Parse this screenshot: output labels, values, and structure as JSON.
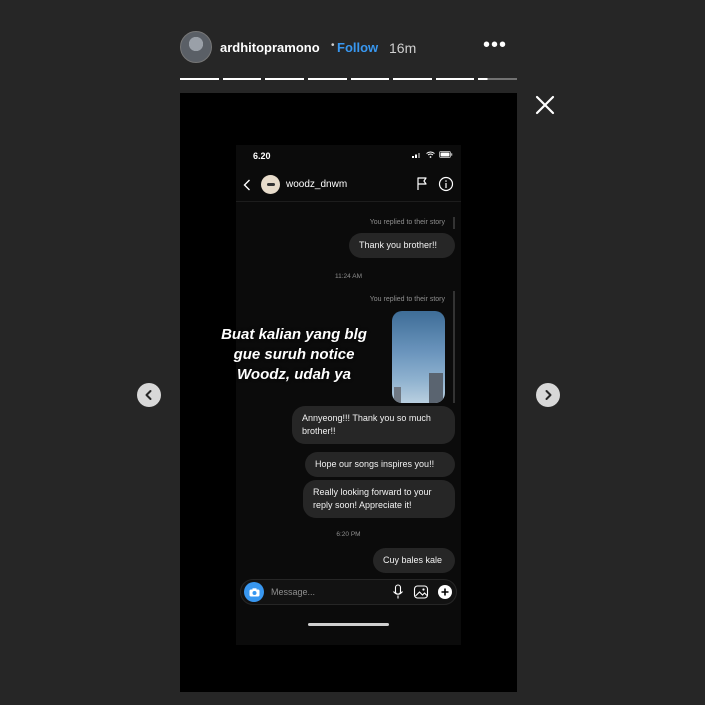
{
  "header": {
    "username": "ardhitopramono",
    "separator": "•",
    "follow_label": "Follow",
    "time_ago": "16m",
    "more_label": "•••"
  },
  "progress": {
    "segments_total": 8,
    "segments_completed": 7,
    "current_segment_fraction": 0.25
  },
  "icons": {
    "close": "close-icon",
    "prev": "chevron-left-icon",
    "next": "chevron-right-icon",
    "more": "more-options-icon"
  },
  "phone": {
    "status_time": "6.20",
    "chat_name": "woodz_dnwm",
    "reply_note_1": "You replied to their story",
    "bubble_1": "Thank you brother!!",
    "timestamp_1": "11:24 AM",
    "reply_note_2": "You replied to their story",
    "story_thumb_text": "",
    "bubble_2": "Annyeong!!! Thank you so much brother!!",
    "bubble_3": "Hope our songs inspires you!!",
    "bubble_4": "Really looking forward to your reply soon! Appreciate it!",
    "timestamp_2": "6:20 PM",
    "bubble_5": "Cuy bales kale",
    "message_placeholder": "Message..."
  },
  "overlay": {
    "line1": "Buat kalian yang blg",
    "line2": "gue suruh notice",
    "line3": "Woodz, udah ya"
  },
  "colors": {
    "page_background": "#262626",
    "follow_blue": "#3897f0",
    "bubble_gray": "#262626",
    "camera_blue": "#3897f0"
  }
}
